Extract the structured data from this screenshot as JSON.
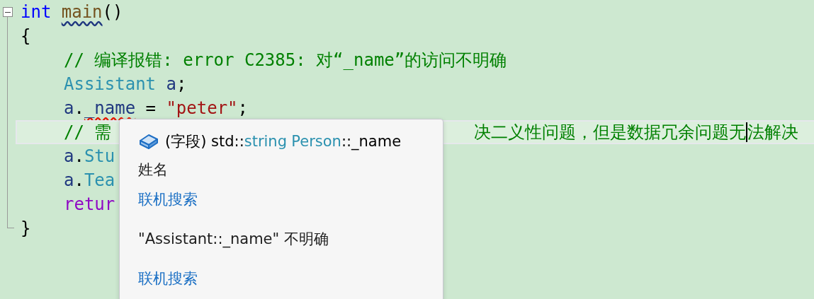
{
  "editor": {
    "lines": [
      {
        "tokens": [
          {
            "text": "int",
            "kind": "keyword"
          },
          {
            "text": "main",
            "kind": "function",
            "spaced": true,
            "squiggle": true,
            "error": false
          },
          {
            "text": "()",
            "kind": "plain"
          }
        ],
        "expanded": true
      },
      {
        "tokens": [
          {
            "text": "{",
            "kind": "plain"
          }
        ],
        "indent": false
      },
      {
        "tokens": [
          {
            "text": "// 编译报错: error C2385: 对“_name”的访问不明确",
            "kind": "comment"
          }
        ],
        "indent": true
      },
      {
        "tokens": [
          {
            "text": "Assistant",
            "kind": "type"
          },
          {
            "text": "a",
            "kind": "variable",
            "spaced": true
          },
          {
            "text": ";",
            "kind": "plain"
          }
        ],
        "indent": true
      },
      {
        "tokens": [
          {
            "text": "a",
            "kind": "variable"
          },
          {
            "text": ".",
            "kind": "plain"
          },
          {
            "text": "_name",
            "kind": "variable",
            "squiggle": true,
            "error": true
          },
          {
            "text": "=",
            "kind": "plain",
            "spaced": true
          },
          {
            "text": "\"peter\"",
            "kind": "string",
            "spaced": true
          },
          {
            "text": ";",
            "kind": "plain"
          }
        ],
        "indent": true
      },
      {
        "tokens": [
          {
            "text": "// 需",
            "kind": "comment"
          }
        ],
        "tail": [
          {
            "text": "决二义性问题，但是数据冗余问题无",
            "kind": "comment"
          },
          {
            "kind": "caret"
          },
          {
            "text": "法解决",
            "kind": "comment"
          }
        ],
        "indent": true,
        "current": true
      },
      {
        "tokens": [
          {
            "text": "a",
            "kind": "variable"
          },
          {
            "text": ".",
            "kind": "plain"
          },
          {
            "text": "Stu",
            "kind": "type"
          }
        ],
        "indent": true
      },
      {
        "tokens": [
          {
            "text": "a",
            "kind": "variable"
          },
          {
            "text": ".",
            "kind": "plain"
          },
          {
            "text": "Tea",
            "kind": "type"
          }
        ],
        "indent": true
      },
      {
        "tokens": [
          {
            "text": "retur",
            "kind": "control"
          }
        ],
        "indent": true
      },
      {
        "tokens": [
          {
            "text": "}",
            "kind": "plain"
          }
        ],
        "indent": false
      }
    ]
  },
  "tooltip": {
    "signature": [
      {
        "text": "(字段) std::",
        "kind": "plain"
      },
      {
        "text": "string",
        "kind": "type"
      },
      {
        "text": "Person",
        "kind": "type",
        "spaced": true
      },
      {
        "text": "::_name",
        "kind": "plain"
      }
    ],
    "description": "姓名",
    "link": "联机搜索",
    "error": "\"Assistant::_name\" 不明确",
    "error_link": "联机搜索"
  }
}
